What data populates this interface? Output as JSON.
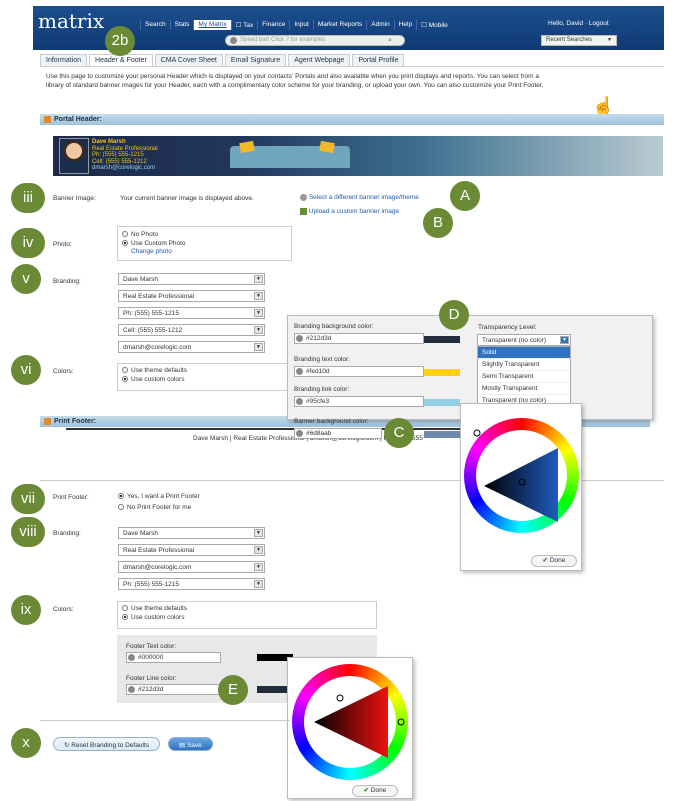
{
  "app": {
    "logo": "matrix",
    "greeting": "Hello, David · Logout"
  },
  "nav": [
    "Search",
    "Stats",
    "My Matrix",
    "☐ Tax",
    "Finance",
    "Input",
    "Market Reports",
    "Admin",
    "Help",
    "☐ Mobile"
  ],
  "search": {
    "placeholder": "Speed bar! Click ? for examples"
  },
  "recent_searches": "Recent Searches",
  "tabs": [
    "Information",
    "Header & Footer",
    "CMA Cover Sheet",
    "Email Signature",
    "Agent Webpage",
    "Portal Profile"
  ],
  "intro": "Use this page to customize your personal Header which is displayed on your contacts' Portals and also available when you print displays and reports. You can select from a library of standard banner images for your Header, each with a complimentary color scheme for your branding, or upload your own. You can also customize your Print Footer.",
  "portal_header": {
    "title": "Portal Header:",
    "banner_lines": [
      "Dave Marsh",
      "Real Estate Professional",
      "Ph: (555) 555-1215",
      "Cell: (555) 555-1212",
      "dmarsh@corelogic.com"
    ],
    "banner_image_label": "Banner Image:",
    "banner_image_text": "Your current banner image is displayed above.",
    "select_link": "Select a different banner image/theme",
    "upload_link": "Upload a custom banner image",
    "photo_label": "Photo:",
    "photo_options": [
      "No Photo",
      "Use Custom Photo"
    ],
    "change_photo": "Change photo",
    "branding_label": "Branding:",
    "branding": [
      "Dave Marsh",
      "Real Estate Professional",
      "Ph: (555) 555-1215",
      "Cell: (555) 555-1212",
      "dmarsh@corelogic.com"
    ],
    "colors_label": "Colors:",
    "colors_options": [
      "Use theme defaults",
      "Use custom colors"
    ]
  },
  "color_panel": {
    "bg_label": "Branding background color:",
    "bg_value": "#212d3d",
    "bg_color": "#212d3d",
    "text_label": "Branding text color:",
    "text_value": "#fed10d",
    "text_color": "#fed10d",
    "link_label": "Branding link color:",
    "link_value": "#95cfe3",
    "link_color": "#95cfe3",
    "banner_label": "Banner background color:",
    "banner_value": "#6d8aab",
    "banner_color": "#6d8aab",
    "transparency_label": "Transparency Level:",
    "transparency_value": "Transparent (no color)",
    "transparency_options": [
      "Solid",
      "Slightly Transparent",
      "Semi Transparent",
      "Mostly Transparent",
      "Transparent (no color)"
    ],
    "done": "Done"
  },
  "print_footer": {
    "title": "Print Footer:",
    "footer_text": "Dave Marsh | Real Estate Professional | dmarsh@corelogic.com | Ph: (555) 555",
    "label": "Print Footer:",
    "options": [
      "Yes, I want a Print Footer",
      "No Print Footer for me"
    ],
    "branding_label": "Branding:",
    "branding": [
      "Dave Marsh",
      "Real Estate Professional",
      "dmarsh@corelogic.com",
      "Ph: (555) 555-1215"
    ],
    "colors_label": "Colors:",
    "colors_options": [
      "Use theme defaults",
      "Use custom colors"
    ],
    "text_color_label": "Footer Text color:",
    "text_color_value": "#000000",
    "text_color": "#000000",
    "line_color_label": "Footer Line color:",
    "line_color_value": "#212d3d",
    "line_color": "#212d3d",
    "done": "Done"
  },
  "actions": {
    "reset": "Reset Branding to Defaults",
    "save": "Save"
  },
  "callouts": {
    "tab": "2b",
    "iii": "iii",
    "iv": "iv",
    "v": "v",
    "vi": "vi",
    "vii": "vii",
    "viii": "viii",
    "ix": "ix",
    "x": "x",
    "A": "A",
    "B": "B",
    "C": "C",
    "D": "D",
    "E": "E"
  },
  "colors": {
    "navbar": "#1c4f8e",
    "callout": "#6a8a36",
    "section": "#9fc2dc"
  }
}
